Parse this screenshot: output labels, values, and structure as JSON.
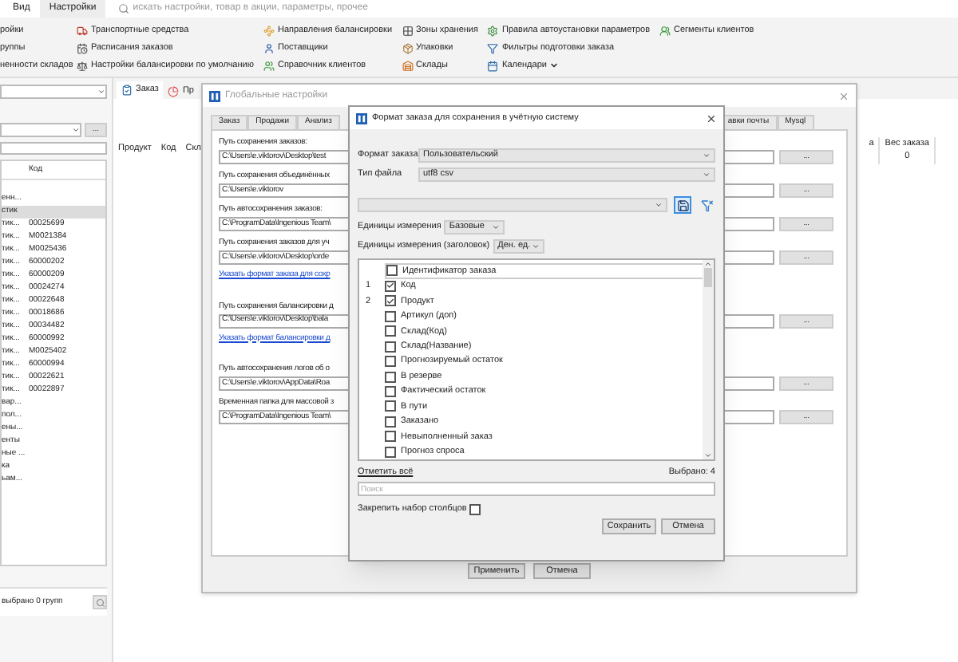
{
  "ribbon_tabs": [
    {
      "label": "Вид",
      "selected": false
    },
    {
      "label": "Настройки",
      "selected": true
    }
  ],
  "search": {
    "placeholder": "искать настройки, товар в акции, параметры, прочее"
  },
  "ribbon_columns": [
    {
      "items": [
        {
          "label": "ройки",
          "kind": "plain"
        },
        {
          "label": "руппы",
          "kind": "plain"
        },
        {
          "label": "ненности складов",
          "kind": "plain"
        }
      ]
    },
    {
      "items": [
        {
          "label": "Транспортные средства",
          "kind": "icon"
        },
        {
          "label": "Расписания заказов",
          "kind": "icon"
        },
        {
          "label": "Настройки балансировки по умолчанию",
          "kind": "icon"
        }
      ]
    },
    {
      "items": [
        {
          "label": "Направления балансировки",
          "kind": "icon"
        },
        {
          "label": "Поставщики",
          "kind": "icon"
        },
        {
          "label": "Справочник клиентов",
          "kind": "icon"
        }
      ]
    },
    {
      "items": [
        {
          "label": "Зоны хранения",
          "kind": "icon"
        },
        {
          "label": "Упаковки",
          "kind": "icon"
        },
        {
          "label": "Склады",
          "kind": "icon"
        }
      ]
    },
    {
      "items": [
        {
          "label": "Правила автоустановки параметров",
          "kind": "icon"
        },
        {
          "label": "Фильтры подготовки заказа",
          "kind": "icon"
        },
        {
          "label": "Календари",
          "kind": "menu"
        }
      ]
    },
    {
      "items": [
        {
          "label": "Сегменты клиентов",
          "kind": "icon"
        }
      ]
    }
  ],
  "left_panel": {
    "browse_button": "...",
    "list_header": "Код",
    "rows": [
      {
        "name": "енн...",
        "selected": false
      },
      {
        "name": "стик",
        "selected": true
      },
      {
        "name": "тик...",
        "code": "00025699",
        "selected": false
      },
      {
        "name": "тик...",
        "code": "M0021384",
        "selected": false
      },
      {
        "name": "тик...",
        "code": "M0025436",
        "selected": false
      },
      {
        "name": "тик...",
        "code": "60000202",
        "selected": false
      },
      {
        "name": "тик...",
        "code": "60000209",
        "selected": false
      },
      {
        "name": "тик...",
        "code": "00024274",
        "selected": false
      },
      {
        "name": "тик...",
        "code": "00022648",
        "selected": false
      },
      {
        "name": "тик...",
        "code": "00018686",
        "selected": false
      },
      {
        "name": "тик...",
        "code": "00034482",
        "selected": false
      },
      {
        "name": "тик...",
        "code": "60000992",
        "selected": false
      },
      {
        "name": "тик...",
        "code": "M0025402",
        "selected": false
      },
      {
        "name": "тик...",
        "code": "60000994",
        "selected": false
      },
      {
        "name": "тик...",
        "code": "00022621",
        "selected": false
      },
      {
        "name": "тик...",
        "code": "00022897",
        "selected": false
      },
      {
        "name": "вар...",
        "selected": false
      },
      {
        "name": "пол...",
        "selected": false
      },
      {
        "name": "ены...",
        "selected": false
      },
      {
        "name": "енты",
        "selected": false
      },
      {
        "name": "ные ...",
        "selected": false
      },
      {
        "name": "ка",
        "selected": false
      },
      {
        "name": "ьам...",
        "selected": false
      }
    ],
    "status": "выбрано 0 групп"
  },
  "main": {
    "tabs": [
      {
        "label": "Заказ",
        "selected": true
      },
      {
        "label": "Пр",
        "selected": false
      }
    ],
    "columns": [
      "Продукт",
      "Код",
      "Скл"
    ],
    "right_columns": [
      {
        "header": "а"
      },
      {
        "header": "Вес заказа",
        "value": "0"
      }
    ]
  },
  "global_settings": {
    "title": "Глобальные настройки",
    "tabs": [
      {
        "label": "Заказ",
        "selected": false
      },
      {
        "label": "Продажи",
        "selected": false
      },
      {
        "label": "Анализ",
        "selected": false
      },
      {
        "label": "авки почты",
        "selected": false
      },
      {
        "label": "Mysql",
        "selected": false
      }
    ],
    "paths": [
      {
        "label": "Путь сохранения заказов:",
        "value": "C:\\Users\\e.viktorov\\Desktop\\test",
        "button": "..."
      },
      {
        "label": "Путь сохранения объединённых",
        "value": "C:\\Users\\e.viktorov",
        "button": "..."
      },
      {
        "label": "Путь автосохранения заказов:",
        "value": "C:\\ProgramData\\Ingenious Team\\",
        "button": "..."
      },
      {
        "label": "Путь сохранения заказов для уч",
        "value": "C:\\Users\\e.viktorov\\Desktop\\orde",
        "button": "...",
        "link": "Указать формат заказа для сохр"
      },
      {
        "label": "Путь сохранения балансировки д",
        "value": "C:\\Users\\e.viktorov\\Desktop\\bala",
        "button": "...",
        "link": "Указать формат балансировки д"
      },
      {
        "label": "Путь автосохранения логов об о",
        "value": "C:\\Users\\e.viktorov\\AppData\\Roa",
        "button": "..."
      },
      {
        "label": "Временная папка для массовой з",
        "value": "C:\\ProgramData\\Ingenious Team\\",
        "button": "..."
      }
    ],
    "buttons": [
      "Применить",
      "Отмена"
    ]
  },
  "format_dialog": {
    "title": "Формат заказа для сохранения в учётную систему",
    "fields": [
      {
        "label": "Формат заказа",
        "value": "Пользовательский"
      },
      {
        "label": "Тип файла",
        "value": "utf8 csv"
      }
    ],
    "units": {
      "label": "Единицы измерения",
      "value": "Базовые"
    },
    "header_units": {
      "label": "Единицы измерения (заголовок)",
      "value": "Ден. ед."
    },
    "columns": [
      {
        "label": "Идентификатор заказа",
        "checked": false,
        "selected": true
      },
      {
        "order": "1",
        "label": "Код",
        "checked": true,
        "selected": false
      },
      {
        "order": "2",
        "label": "Продукт",
        "checked": true,
        "selected": false
      },
      {
        "label": "Артикул (доп)",
        "checked": false,
        "selected": false
      },
      {
        "label": "Склад(Код)",
        "checked": false,
        "selected": false
      },
      {
        "label": "Склад(Название)",
        "checked": false,
        "selected": false
      },
      {
        "label": "Прогнозируемый остаток",
        "checked": false,
        "selected": false
      },
      {
        "label": "В резерве",
        "checked": false,
        "selected": false
      },
      {
        "label": "Фактический остаток",
        "checked": false,
        "selected": false
      },
      {
        "label": "В пути",
        "checked": false,
        "selected": false
      },
      {
        "label": "Заказано",
        "checked": false,
        "selected": false
      },
      {
        "label": "Невыполненный заказ",
        "checked": false,
        "selected": false
      },
      {
        "label": "Прогноз спроса",
        "checked": false,
        "selected": false
      }
    ],
    "select_all": "Отметить всё",
    "selected_count": "Выбрано: 4",
    "search": {
      "placeholder": "Поиск"
    },
    "pin": {
      "label": "Закрепить набор столбцов",
      "checked": false
    },
    "buttons": [
      "Сохранить",
      "Отмена"
    ]
  }
}
